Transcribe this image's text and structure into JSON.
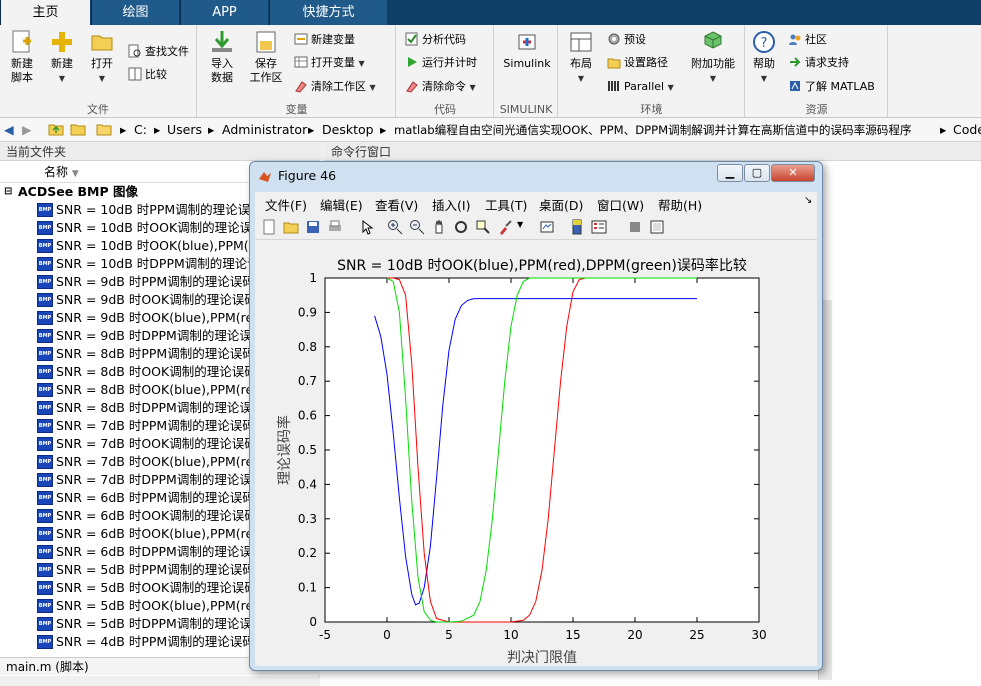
{
  "tabs": [
    "主页",
    "绘图",
    "APP",
    "快捷方式"
  ],
  "ribbon": {
    "file": {
      "new_script": "新建\n脚本",
      "new": "新建",
      "open": "打开",
      "find_files": "查找文件",
      "compare": "比较",
      "group": "文件"
    },
    "variable": {
      "import_data": "导入\n数据",
      "save_workspace": "保存\n工作区",
      "new_variable": "新建变量",
      "open_variable": "打开变量",
      "clear_workspace": "清除工作区",
      "group": "变量"
    },
    "code": {
      "analyze": "分析代码",
      "run_timing": "运行并计时",
      "clear_commands": "清除命令",
      "group": "代码"
    },
    "simulink": {
      "simulink": "Simulink",
      "group": "SIMULINK"
    },
    "env": {
      "layout": "布局",
      "preferences": "预设",
      "set_path": "设置路径",
      "parallel": "Parallel",
      "addons": "附加功能",
      "group": "环境"
    },
    "resources": {
      "help": "帮助",
      "community": "社区",
      "request_support": "请求支持",
      "learn": "了解 MATLAB",
      "group": "资源"
    }
  },
  "address": [
    "C:",
    "Users",
    "Administrator",
    "Desktop",
    "matlab编程自由空间光通信实现OOK、PPM、DPPM调制解调并计算在高斯信道中的误码率源码程序",
    "Code"
  ],
  "left_panel": {
    "title": "当前文件夹",
    "column": "名称",
    "group": "ACDSee BMP 图像",
    "items": [
      "SNR = 10dB 时PPM调制的理论误码",
      "SNR = 10dB 时OOK调制的理论误码",
      "SNR = 10dB 时OOK(blue),PPM(red",
      "SNR = 10dB 时DPPM调制的理论误码",
      "SNR = 9dB 时PPM调制的理论误码",
      "SNR = 9dB 时OOK调制的理论误码",
      "SNR = 9dB 时OOK(blue),PPM(red",
      "SNR = 9dB 时DPPM调制的理论误码",
      "SNR = 8dB 时PPM调制的理论误码",
      "SNR = 8dB 时OOK调制的理论误码",
      "SNR = 8dB 时OOK(blue),PPM(red",
      "SNR = 8dB 时DPPM调制的理论误码",
      "SNR = 7dB 时PPM调制的理论误码",
      "SNR = 7dB 时OOK调制的理论误码",
      "SNR = 7dB 时OOK(blue),PPM(red",
      "SNR = 7dB 时DPPM调制的理论误码",
      "SNR = 6dB 时PPM调制的理论误码",
      "SNR = 6dB 时OOK调制的理论误码",
      "SNR = 6dB 时OOK(blue),PPM(red",
      "SNR = 6dB 时DPPM调制的理论误码",
      "SNR = 5dB 时PPM调制的理论误码",
      "SNR = 5dB 时OOK调制的理论误码",
      "SNR = 5dB 时OOK(blue),PPM(red",
      "SNR = 5dB 时DPPM调制的理论误码",
      "SNR = 4dB 时PPM调制的理论误码"
    ],
    "status": "main.m  (脚本)"
  },
  "right_panel": {
    "title": "命令行窗口"
  },
  "figure": {
    "title": "Figure 46",
    "menu": [
      "文件(F)",
      "编辑(E)",
      "查看(V)",
      "插入(I)",
      "工具(T)",
      "桌面(D)",
      "窗口(W)",
      "帮助(H)"
    ]
  },
  "chart_data": {
    "type": "line",
    "title": "SNR = 10dB 时OOK(blue),PPM(red),DPPM(green)误码率比较",
    "xlabel": "判决门限值",
    "ylabel": "理论误码率",
    "xlim": [
      -5,
      30
    ],
    "ylim": [
      0,
      1
    ],
    "xticks": [
      -5,
      0,
      5,
      10,
      15,
      20,
      25,
      30
    ],
    "yticks": [
      0,
      0.1,
      0.2,
      0.3,
      0.4,
      0.5,
      0.6,
      0.7,
      0.8,
      0.9,
      1
    ],
    "series": [
      {
        "color": "#0000ff",
        "x": [
          -1,
          -0.5,
          0,
          0.5,
          1,
          1.5,
          2,
          2.3,
          2.6,
          3,
          3.5,
          4,
          4.5,
          5,
          5.5,
          6,
          6.5,
          7,
          8,
          10,
          15,
          20,
          25
        ],
        "y": [
          0.89,
          0.83,
          0.72,
          0.55,
          0.36,
          0.19,
          0.08,
          0.05,
          0.055,
          0.1,
          0.22,
          0.42,
          0.63,
          0.79,
          0.88,
          0.92,
          0.935,
          0.94,
          0.94,
          0.94,
          0.94,
          0.94,
          0.94
        ]
      },
      {
        "color": "#ff0000",
        "x": [
          0,
          0.5,
          1,
          1.5,
          2,
          2.5,
          3,
          3.5,
          4,
          5,
          8,
          10,
          11,
          11.5,
          12,
          12.5,
          13,
          13.5,
          14,
          14.5,
          15,
          15.5,
          16,
          25
        ],
        "y": [
          1,
          1,
          0.995,
          0.95,
          0.75,
          0.45,
          0.2,
          0.06,
          0.01,
          0,
          0,
          0,
          0.005,
          0.02,
          0.06,
          0.15,
          0.3,
          0.5,
          0.7,
          0.86,
          0.96,
          0.995,
          1,
          1
        ]
      },
      {
        "color": "#00dd00",
        "x": [
          0,
          0.5,
          1,
          1.5,
          2,
          2.5,
          3,
          3.5,
          4,
          5,
          6,
          7,
          7.5,
          8,
          8.5,
          9,
          9.5,
          10,
          10.5,
          11,
          11.5,
          12,
          25
        ],
        "y": [
          1,
          0.99,
          0.9,
          0.65,
          0.35,
          0.13,
          0.03,
          0.005,
          0,
          0,
          0.002,
          0.02,
          0.06,
          0.15,
          0.3,
          0.5,
          0.7,
          0.86,
          0.95,
          0.99,
          1,
          1,
          1
        ]
      }
    ]
  }
}
